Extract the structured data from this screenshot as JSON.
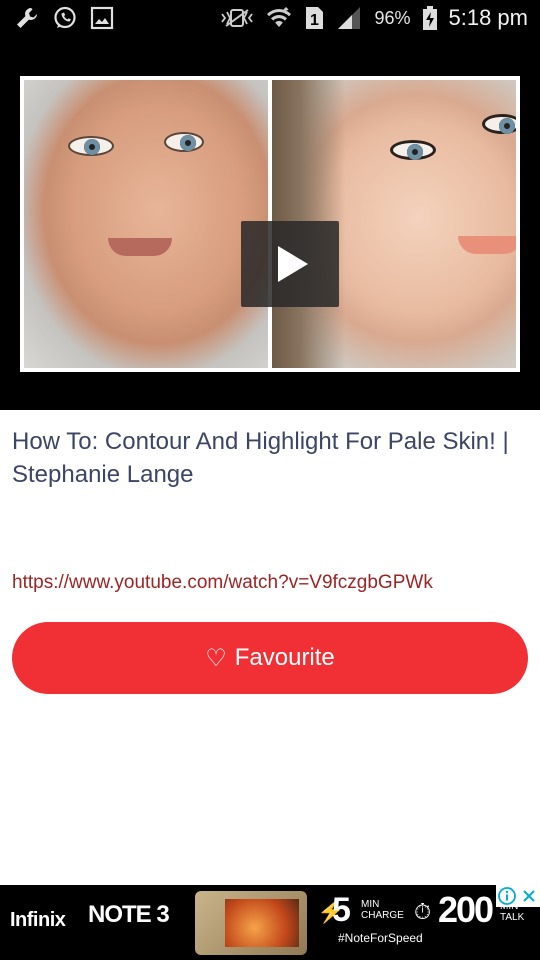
{
  "status_bar": {
    "battery_percent": "96%",
    "time": "5:18 pm",
    "sim_label": "1",
    "left_icons": [
      "wrench-icon",
      "whatsapp-icon",
      "gallery-icon"
    ],
    "right_icons": [
      "vibrate-icon",
      "wifi-icon",
      "sim-icon",
      "signal-icon",
      "battery-charging-icon"
    ]
  },
  "video": {
    "title": "How To: Contour And Highlight For Pale Skin! | Stephanie Lange",
    "url": "https://www.youtube.com/watch?v=V9fczgbGPWk",
    "play_icon": "play-icon"
  },
  "favourite_button": {
    "icon": "♡",
    "label": "Favourite",
    "color": "#f03035"
  },
  "ad": {
    "brand": "Infinix",
    "model": "NOTE 3",
    "charge_value": "5",
    "charge_unit": "MIN CHARGE",
    "talk_value": "200",
    "talk_unit": "MIN TALK",
    "hashtag": "#NoteForSpeed"
  },
  "colors": {
    "title": "#3c4566",
    "url": "#9c2424",
    "accent": "#f03035"
  }
}
